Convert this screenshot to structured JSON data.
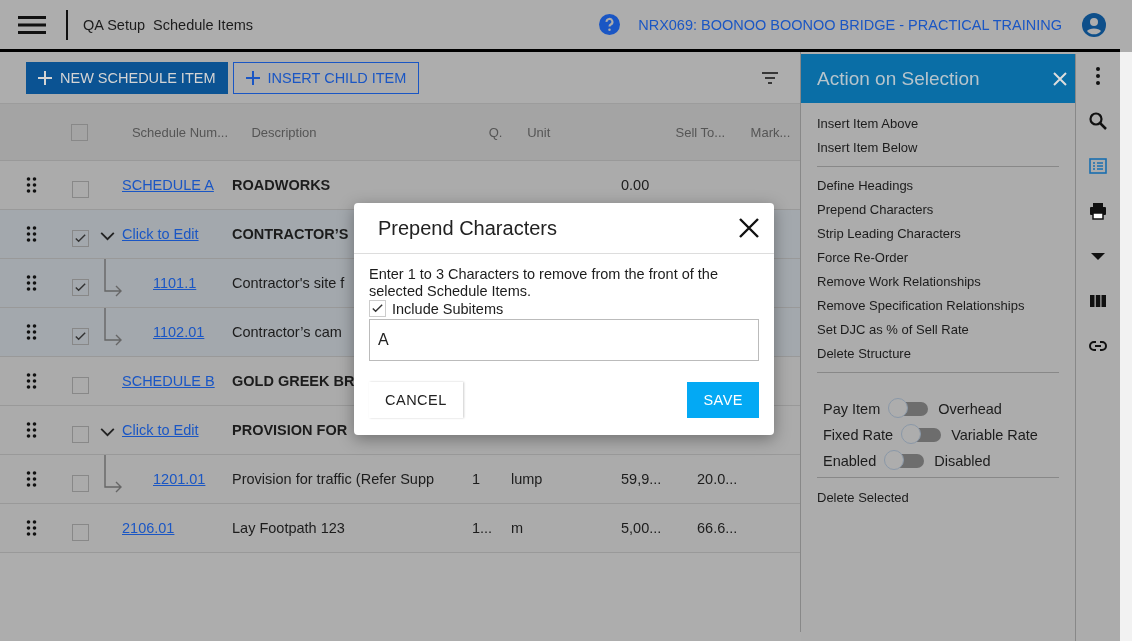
{
  "header": {
    "breadcrumb": [
      "QA Setup",
      "Schedule Items"
    ],
    "project": "NRX069: BOONOO BOONOO BRIDGE - PRACTICAL TRAINING"
  },
  "toolbar": {
    "buttons": [
      {
        "label": "NEW SCHEDULE ITEM",
        "kind": "primary"
      },
      {
        "label": "INSERT CHILD ITEM",
        "kind": "outline"
      }
    ]
  },
  "table": {
    "select_all": false,
    "columns": [
      "Schedule Num...",
      "Description",
      "Q.",
      "Unit",
      "Sell To...",
      "Mark..."
    ],
    "rows": [
      {
        "kind": "heading",
        "selected": false,
        "expander": false,
        "number": "SCHEDULE A",
        "description": "ROADWORKS",
        "q": "",
        "unit": "",
        "sell": "0.00",
        "mark": ""
      },
      {
        "kind": "heading",
        "selected": true,
        "expander": true,
        "number": "Click to Edit",
        "description": "CONTRACTOR’S",
        "q": "",
        "unit": "",
        "sell": "",
        "mark": ""
      },
      {
        "kind": "child",
        "selected": true,
        "expander": false,
        "number": "1101.1",
        "description": "Contractor's site f",
        "q": "",
        "unit": "",
        "sell": "",
        "mark": ""
      },
      {
        "kind": "child",
        "selected": true,
        "expander": false,
        "number": "1102.01",
        "description": "Contractor’s cam",
        "q": "",
        "unit": "",
        "sell": "",
        "mark": ""
      },
      {
        "kind": "heading",
        "selected": false,
        "expander": false,
        "number": "SCHEDULE B",
        "description": "GOLD GREEK BR",
        "q": "",
        "unit": "",
        "sell": "",
        "mark": ""
      },
      {
        "kind": "heading",
        "selected": false,
        "expander": true,
        "number": "Click to Edit",
        "description": "PROVISION FOR",
        "q": "",
        "unit": "",
        "sell": "",
        "mark": ""
      },
      {
        "kind": "child",
        "selected": false,
        "expander": false,
        "number": "1201.01",
        "description": "Provision for traffic (Refer Supp",
        "q": "1",
        "unit": "lump",
        "sell": "59,9...",
        "mark": "20.0..."
      },
      {
        "kind": "item",
        "selected": false,
        "expander": false,
        "number": "2106.01",
        "description": "Lay Footpath 123",
        "q": "1...",
        "unit": "m",
        "sell": "5,00...",
        "mark": "66.6..."
      }
    ]
  },
  "dialog": {
    "title": "Prepend Characters",
    "message": "Enter 1 to 3 Characters to remove from the front of the selected Schedule Items.",
    "include_subitems": {
      "label": "Include Subitems",
      "checked": true
    },
    "value": "A",
    "buttons": [
      {
        "label": "CANCEL",
        "kind": "flat"
      },
      {
        "label": "SAVE",
        "kind": "primary"
      }
    ]
  },
  "action_panel": {
    "title": "Action on Selection",
    "groups": [
      [
        "Insert Item Above",
        "Insert Item Below"
      ],
      [
        "Define Headings",
        "Prepend Characters",
        "Strip Leading Characters",
        "Force Re-Order",
        "Remove Work Relationships",
        "Remove Specification Relationships",
        "Set DJC as % of Sell Rate",
        "Delete Structure"
      ]
    ],
    "toggles": [
      {
        "left": "Pay Item",
        "right": "Overhead",
        "on": false
      },
      {
        "left": "Fixed Rate",
        "right": "Variable Rate",
        "on": false
      },
      {
        "left": "Enabled",
        "right": "Disabled",
        "on": false
      }
    ],
    "footer_action": "Delete Selected"
  }
}
